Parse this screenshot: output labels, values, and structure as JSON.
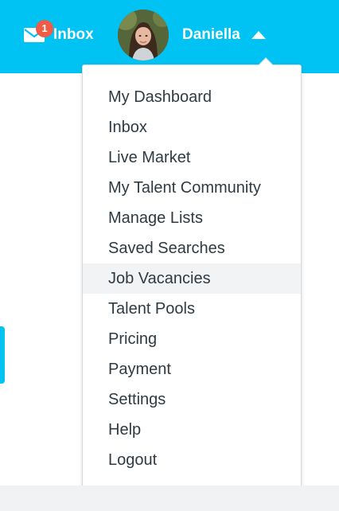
{
  "header": {
    "inbox_label": "Inbox",
    "inbox_badge": "1",
    "inbox_icon": "envelope-icon",
    "user_name": "Daniella",
    "user_menu_icon": "caret-up-icon",
    "brand_color": "#00c3f3",
    "badge_color": "#ef5b44"
  },
  "user_menu": {
    "items": [
      {
        "label": "My Dashboard"
      },
      {
        "label": "Inbox"
      },
      {
        "label": "Live Market"
      },
      {
        "label": "My Talent Community"
      },
      {
        "label": "Manage Lists"
      },
      {
        "label": "Saved Searches"
      },
      {
        "label": "Job Vacancies",
        "highlighted": true
      },
      {
        "label": "Talent Pools"
      },
      {
        "label": "Pricing"
      },
      {
        "label": "Payment"
      },
      {
        "label": "Settings"
      },
      {
        "label": "Help"
      },
      {
        "label": "Logout"
      }
    ]
  }
}
